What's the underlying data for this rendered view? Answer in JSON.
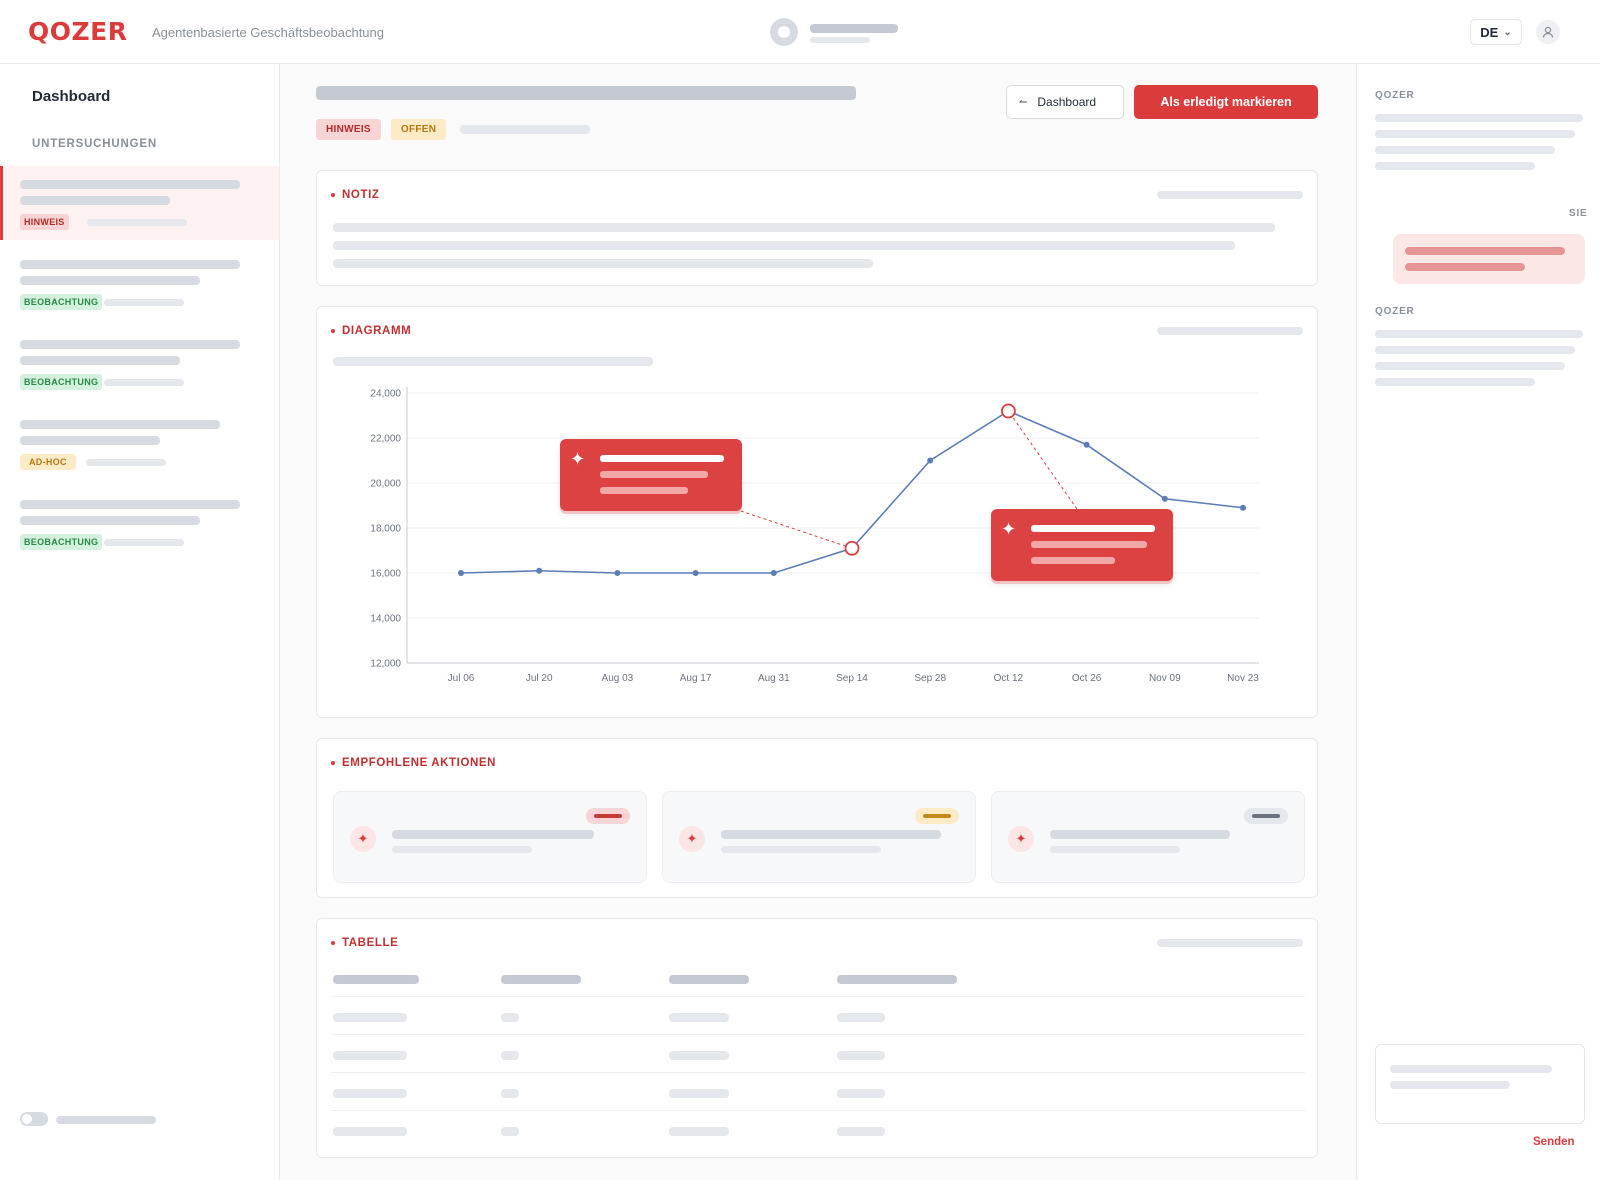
{
  "header": {
    "logo": "QOZER",
    "tagline": "Agentenbasierte Geschäftsbeobachtung",
    "language": "DE"
  },
  "sidebar": {
    "title": "Dashboard",
    "section": "UNTERSUCHUNGEN",
    "items": [
      {
        "badge": "HINWEIS",
        "type": "hinweis",
        "active": true
      },
      {
        "badge": "BEOBACHTUNG",
        "type": "beob",
        "active": false
      },
      {
        "badge": "BEOBACHTUNG",
        "type": "beob",
        "active": false
      },
      {
        "badge": "AD-HOC",
        "type": "adhoc",
        "active": false
      },
      {
        "badge": "BEOBACHTUNG",
        "type": "beob",
        "active": false
      }
    ]
  },
  "main": {
    "badges": {
      "type": "HINWEIS",
      "status": "OFFEN"
    },
    "buttons": {
      "dashboard": "Dashboard",
      "mark_done": "Als erledigt markieren"
    },
    "sections": {
      "note": "NOTIZ",
      "chart": "DIAGRAMM",
      "actions": "EMPFOHLENE AKTIONEN",
      "table": "TABELLE"
    }
  },
  "chart_data": {
    "type": "line",
    "categories": [
      "Jul 06",
      "Jul 20",
      "Aug 03",
      "Aug 17",
      "Aug 31",
      "Sep 14",
      "Sep 28",
      "Oct 12",
      "Oct 26",
      "Nov 09",
      "Nov 23"
    ],
    "values": [
      16000,
      16100,
      16000,
      16000,
      16000,
      17100,
      21000,
      23200,
      21700,
      19300,
      18900
    ],
    "ylim": [
      12000,
      24000
    ],
    "yticks": [
      "24,000",
      "22,000",
      "20,000",
      "18,000",
      "16,000",
      "14,000",
      "12,000"
    ],
    "highlighted": [
      5,
      7
    ],
    "grid": true,
    "line_color": "#5b7db8",
    "highlight_color": "#dc3b3b"
  },
  "right_panel": {
    "label_agent": "QOZER",
    "label_user": "SIE",
    "label_agent2": "QOZER",
    "send": "Senden"
  },
  "colors": {
    "accent": "#dc3b3b"
  }
}
